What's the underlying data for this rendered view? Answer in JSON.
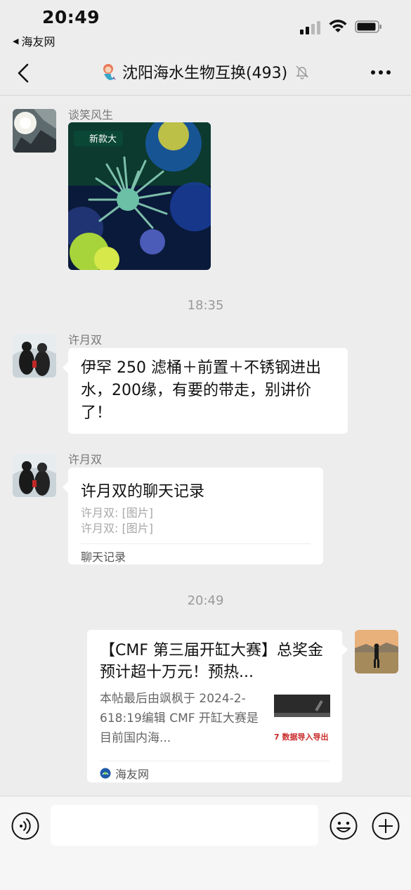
{
  "status_bar": {
    "time": "20:49",
    "back_app_label": "海友网"
  },
  "navbar": {
    "title": "沈阳海水生物互换(493)",
    "back_icon": "chevron-left-icon",
    "mute_icon": "bell-off-icon",
    "more_icon": "more-dots-icon"
  },
  "messages": [
    {
      "type": "image",
      "sender": "谈笑风生",
      "image_label": "新款大"
    },
    {
      "type": "timestamp",
      "time": "18:35"
    },
    {
      "type": "text",
      "sender": "许月双",
      "text": "伊罕 250 滤桶＋前置＋不锈钢进出水，200缘，有要的带走，别讲价了！"
    },
    {
      "type": "chat_record",
      "sender": "许月双",
      "title": "许月双的聊天记录",
      "lines": [
        "许月双: [图片]",
        "许月双: [图片]"
      ],
      "footer": "聊天记录"
    },
    {
      "type": "timestamp",
      "time": "20:49"
    },
    {
      "type": "link",
      "title": "【CMF 第三届开缸大赛】总奖金预计超十万元！预热...",
      "description": "本帖最后由飒枫于 2024-2-618:19编辑 CMF 开缸大赛是目前国内海...",
      "thumb_text": "7 数据导入导出",
      "source": "海友网"
    }
  ],
  "input_bar": {
    "placeholder": "",
    "voice_icon": "voice-icon",
    "emoji_icon": "emoji-icon",
    "plus_icon": "plus-icon"
  },
  "colors": {
    "background": "#ededed",
    "bubble": "#ffffff",
    "timestamp": "#9a9a9a"
  }
}
